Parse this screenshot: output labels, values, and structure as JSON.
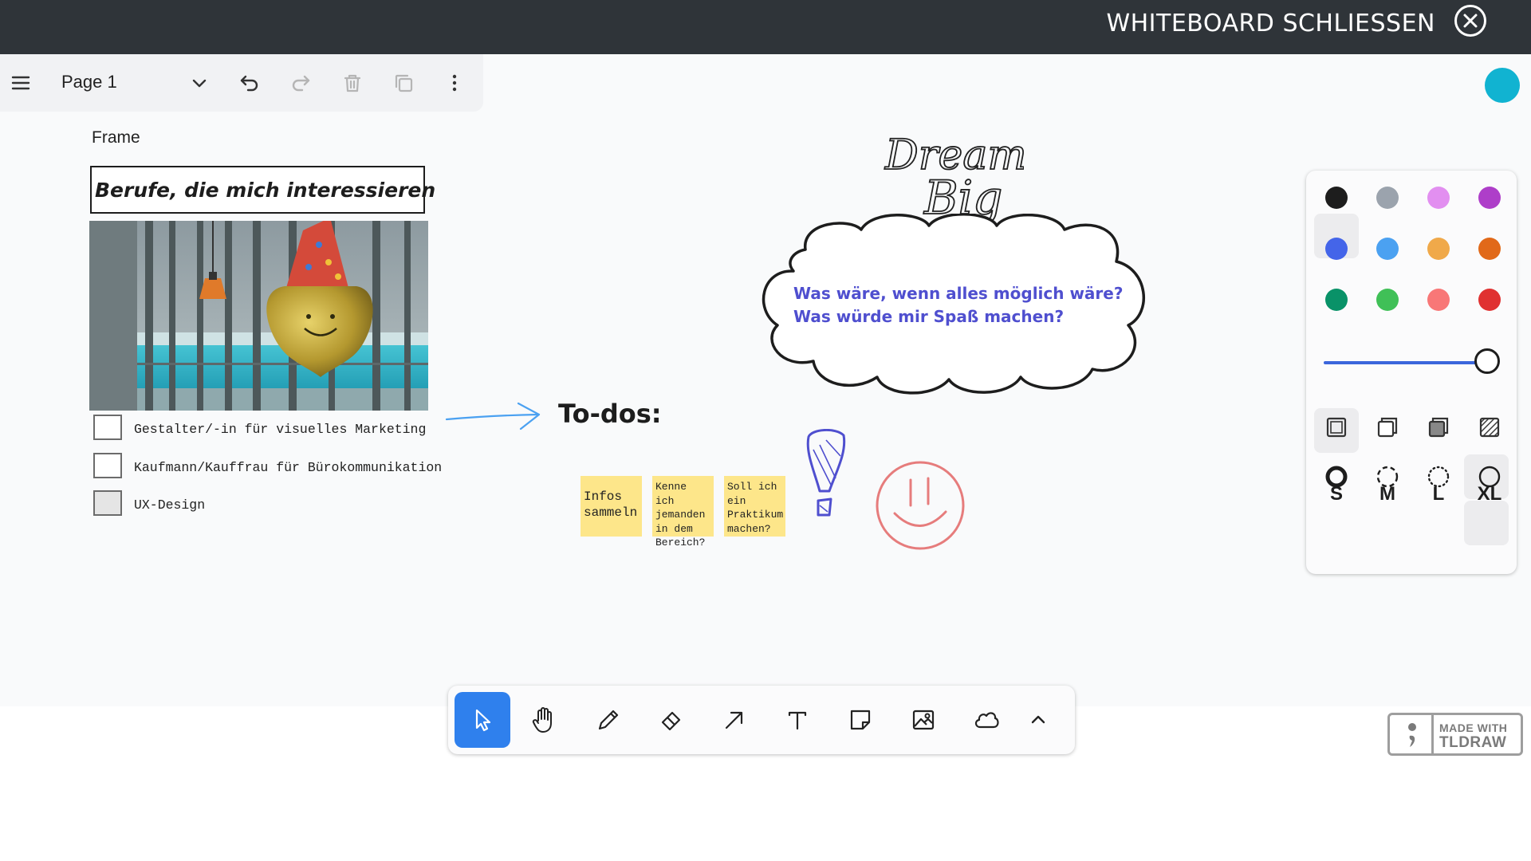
{
  "header": {
    "close_label": "WHITEBOARD SCHLIESSEN"
  },
  "menu": {
    "page_name": "Page 1"
  },
  "frame": {
    "label": "Frame",
    "title": "Berufe, die mich interessieren",
    "checklist": [
      {
        "label": "Gestalter/-in für visuelles Marketing",
        "checked": false
      },
      {
        "label": "Kaufmann/Kauffrau für Bürokommunikation",
        "checked": false
      },
      {
        "label": "UX-Design",
        "checked": false
      }
    ]
  },
  "canvas": {
    "todos_heading": "To-dos:",
    "sticky_notes": [
      "Infos sammeln",
      "Kenne ich jemanden in dem Bereich?",
      "Soll ich ein Praktikum machen?"
    ],
    "dream_line1": "Dream",
    "dream_line2": "Big",
    "cloud_line1": "Was wäre, wenn alles möglich wäre?",
    "cloud_line2": "Was würde mir Spaß machen?"
  },
  "style_panel": {
    "colors": [
      "#1d1d1d",
      "#9ba3ad",
      "#e28ff0",
      "#ae3ec9",
      "#4465e9",
      "#4ba1f1",
      "#f0a94a",
      "#e16919",
      "#099268",
      "#40c057",
      "#f87777",
      "#e03131"
    ],
    "selected_color": "#4465e9",
    "opacity_percent": 100,
    "selected_fill": "none",
    "selected_dash": "solid",
    "sizes": [
      "S",
      "M",
      "L",
      "XL"
    ],
    "selected_size": "XL"
  },
  "branding": {
    "line1": "MADE WITH",
    "line2": "TLDRAW"
  }
}
